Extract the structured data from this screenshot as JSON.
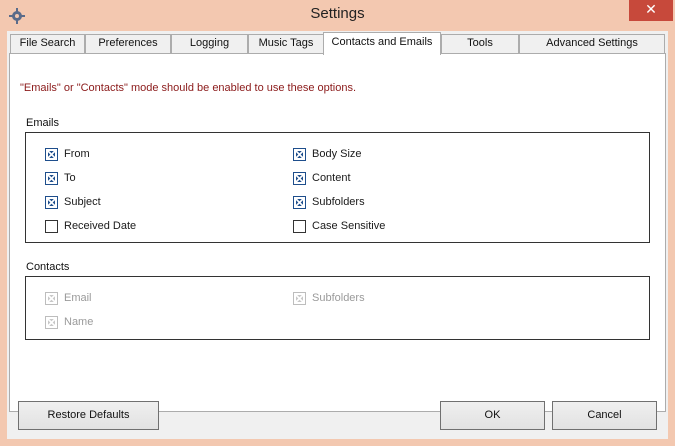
{
  "window": {
    "title": "Settings",
    "close_symbol": "✕"
  },
  "tabs": [
    {
      "label": "File Search"
    },
    {
      "label": "Preferences"
    },
    {
      "label": "Logging"
    },
    {
      "label": "Music Tags"
    },
    {
      "label": "Contacts and Emails",
      "active": true
    },
    {
      "label": "Tools"
    },
    {
      "label": "Advanced Settings"
    }
  ],
  "notice": "\"Emails\" or \"Contacts\" mode should be enabled to use these options.",
  "emails": {
    "label": "Emails",
    "options": [
      {
        "label": "From",
        "checked": true
      },
      {
        "label": "To",
        "checked": true
      },
      {
        "label": "Subject",
        "checked": true
      },
      {
        "label": "Received Date",
        "checked": false
      },
      {
        "label": "Body Size",
        "checked": true
      },
      {
        "label": "Content",
        "checked": true
      },
      {
        "label": "Subfolders",
        "checked": true
      },
      {
        "label": "Case Sensitive",
        "checked": false
      }
    ]
  },
  "contacts": {
    "label": "Contacts",
    "options": [
      {
        "label": "Email",
        "checked": true,
        "disabled": true
      },
      {
        "label": "Name",
        "checked": true,
        "disabled": true
      },
      {
        "label": "Subfolders",
        "checked": true,
        "disabled": true
      }
    ]
  },
  "buttons": {
    "restore": "Restore Defaults",
    "ok": "OK",
    "cancel": "Cancel"
  },
  "icons": {
    "app": "gear-icon",
    "close": "close-icon",
    "check": "check-icon"
  },
  "colors": {
    "titlebar": "#f3c8b0",
    "close": "#c7493b",
    "notice": "#8b1a1a",
    "check": "#1e4e8c"
  }
}
